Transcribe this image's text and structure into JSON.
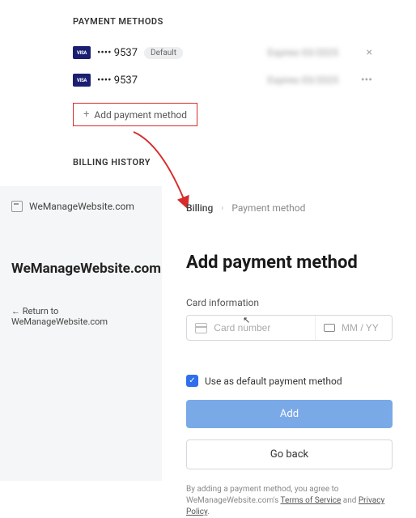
{
  "payment_methods": {
    "section_title": "PAYMENT METHODS",
    "cards": [
      {
        "brand": "VISA",
        "masked": "•••• 9537",
        "default_label": "Default",
        "expires_blur": "Expires 03/2025",
        "action": "×"
      },
      {
        "brand": "VISA",
        "masked": "•••• 9537",
        "default_label": "",
        "expires_blur": "Expires 03/2025",
        "action": "•••"
      }
    ],
    "add_button": "Add payment method"
  },
  "billing_history_title": "BILLING HISTORY",
  "left_panel": {
    "account": "WeManageWebsite.com",
    "brand": "WeManageWebsite.com",
    "return": "← Return to WeManageWebsite.com"
  },
  "breadcrumb": {
    "root": "Billing",
    "current": "Payment method"
  },
  "form": {
    "heading": "Add payment method",
    "card_info_label": "Card information",
    "card_placeholder": "Card number",
    "expiry_placeholder": "MM / YY",
    "default_checkbox": "Use as default payment method",
    "add_button": "Add",
    "goback_button": "Go back"
  },
  "legal": {
    "line1": "By adding a payment method, you agree to",
    "site": "WeManageWebsite.com's ",
    "tos": "Terms of Service",
    "and": " and ",
    "pp": "Privacy Policy",
    "dot": "."
  }
}
